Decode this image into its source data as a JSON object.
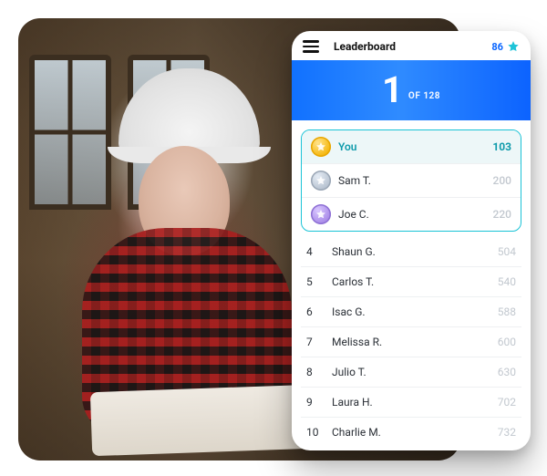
{
  "header": {
    "title": "Leaderboard",
    "points": "86"
  },
  "rank": {
    "position": "1",
    "of_label": "OF",
    "total": "128"
  },
  "top": [
    {
      "name": "You",
      "score": "103",
      "medal": "gold",
      "is_you": true
    },
    {
      "name": "Sam T.",
      "score": "200",
      "medal": "silver",
      "is_you": false
    },
    {
      "name": "Joe C.",
      "score": "220",
      "medal": "bronze",
      "is_you": false
    }
  ],
  "others": [
    {
      "rank": "4",
      "name": "Shaun G.",
      "score": "504"
    },
    {
      "rank": "5",
      "name": "Carlos T.",
      "score": "540"
    },
    {
      "rank": "6",
      "name": "Isac G.",
      "score": "588"
    },
    {
      "rank": "7",
      "name": "Melissa R.",
      "score": "600"
    },
    {
      "rank": "8",
      "name": "Julio T.",
      "score": "630"
    },
    {
      "rank": "9",
      "name": "Laura H.",
      "score": "702"
    },
    {
      "rank": "10",
      "name": "Charlie M.",
      "score": "732"
    }
  ],
  "colors": {
    "accent_blue": "#1171ff",
    "accent_teal": "#19c3d6"
  }
}
